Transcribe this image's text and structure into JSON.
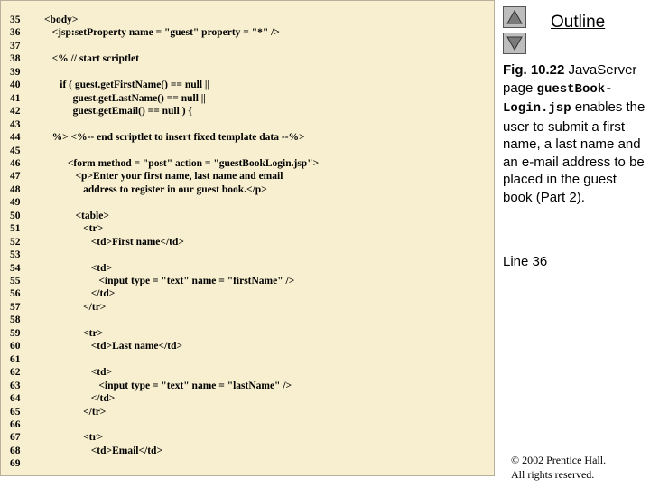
{
  "code": {
    "lines": [
      {
        "num": "35",
        "text": "<body>"
      },
      {
        "num": "36",
        "text": "   <jsp:setProperty name = \"guest\" property = \"*\" />"
      },
      {
        "num": "37",
        "text": ""
      },
      {
        "num": "38",
        "text": "   <% // start scriptlet"
      },
      {
        "num": "39",
        "text": ""
      },
      {
        "num": "40",
        "text": "      if ( guest.getFirstName() == null ||"
      },
      {
        "num": "41",
        "text": "           guest.getLastName() == null ||"
      },
      {
        "num": "42",
        "text": "           guest.getEmail() == null ) {"
      },
      {
        "num": "43",
        "text": ""
      },
      {
        "num": "44",
        "text": "   %> <%-- end scriptlet to insert fixed template data --%>"
      },
      {
        "num": "45",
        "text": ""
      },
      {
        "num": "46",
        "text": "         <form method = \"post\" action = \"guestBookLogin.jsp\">"
      },
      {
        "num": "47",
        "text": "            <p>Enter your first name, last name and email"
      },
      {
        "num": "48",
        "text": "               address to register in our guest book.</p>"
      },
      {
        "num": "49",
        "text": ""
      },
      {
        "num": "50",
        "text": "            <table>"
      },
      {
        "num": "51",
        "text": "               <tr>"
      },
      {
        "num": "52",
        "text": "                  <td>First name</td>"
      },
      {
        "num": "53",
        "text": ""
      },
      {
        "num": "54",
        "text": "                  <td>"
      },
      {
        "num": "55",
        "text": "                     <input type = \"text\" name = \"firstName\" />"
      },
      {
        "num": "56",
        "text": "                  </td>"
      },
      {
        "num": "57",
        "text": "               </tr>"
      },
      {
        "num": "58",
        "text": ""
      },
      {
        "num": "59",
        "text": "               <tr>"
      },
      {
        "num": "60",
        "text": "                  <td>Last name</td>"
      },
      {
        "num": "61",
        "text": ""
      },
      {
        "num": "62",
        "text": "                  <td>"
      },
      {
        "num": "63",
        "text": "                     <input type = \"text\" name = \"lastName\" />"
      },
      {
        "num": "64",
        "text": "                  </td>"
      },
      {
        "num": "65",
        "text": "               </tr>"
      },
      {
        "num": "66",
        "text": ""
      },
      {
        "num": "67",
        "text": "               <tr>"
      },
      {
        "num": "68",
        "text": "                  <td>Email</td>"
      },
      {
        "num": "69",
        "text": ""
      }
    ]
  },
  "nav": {
    "up_icon": "triangle-up-icon",
    "down_icon": "triangle-down-icon"
  },
  "outline": {
    "title": "Outline"
  },
  "caption": {
    "fig": "Fig. 10.22",
    "part1": " JavaServer page ",
    "file_a": "guestBook-",
    "file_b": "Login.jsp",
    "part2": " enables the user to submit a first name, a last name and an e-mail address to be placed in the guest book (Part 2)."
  },
  "line_ref": "Line 36",
  "copyright": {
    "line1": "© 2002 Prentice Hall.",
    "line2": "All rights reserved."
  },
  "colors": {
    "code_background": "#f7efcf",
    "button_gray": "#bdbdbd"
  }
}
